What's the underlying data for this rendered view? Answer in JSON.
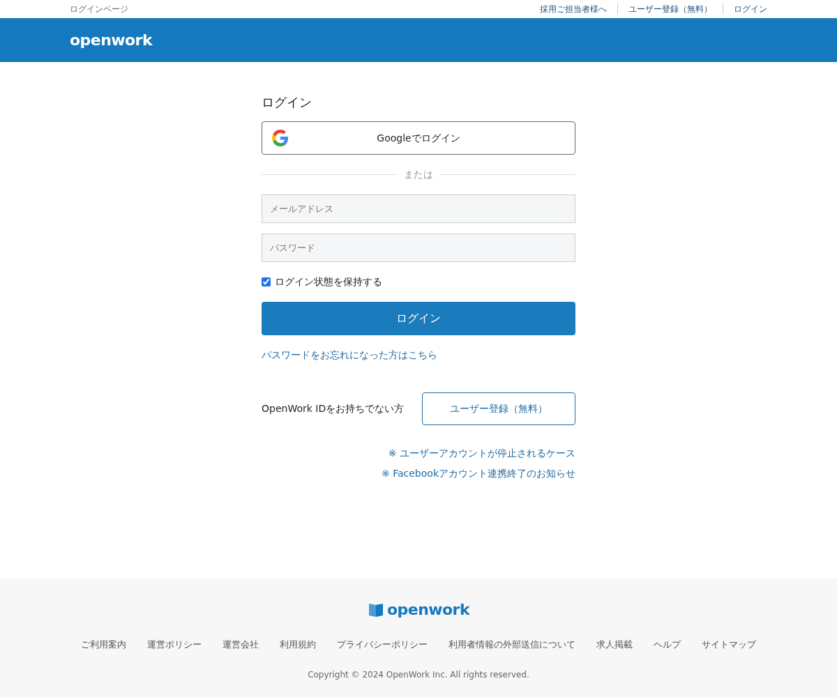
{
  "top_bar": {
    "page_label": "ログインページ",
    "links": [
      "採用ご担当者様へ",
      "ユーザー登録（無料）",
      "ログイン"
    ]
  },
  "header": {
    "logo": "openwork"
  },
  "login": {
    "title": "ログイン",
    "google_button": "Googleでログイン",
    "divider": "または",
    "email": {
      "placeholder": "メールアドレス"
    },
    "password": {
      "placeholder": "パスワード"
    },
    "remember": {
      "label": "ログイン状態を保持する",
      "checked": true
    },
    "submit": "ログイン",
    "forgot_link": "パスワードをお忘れになった方はこちら",
    "register_prompt": "OpenWork IDをお持ちでない方",
    "register_button": "ユーザー登録（無料）",
    "notices": [
      "※ ユーザーアカウントが停止されるケース",
      "※ Facebookアカウント連携終了のお知らせ"
    ]
  },
  "footer": {
    "logo": "openwork",
    "links": [
      "ご利用案内",
      "運営ポリシー",
      "運営会社",
      "利用規約",
      "プライバシーポリシー",
      "利用者情報の外部送信について",
      "求人掲載",
      "ヘルプ",
      "サイトマップ"
    ],
    "copyright": "Copyright © 2024 OpenWork Inc. All rights reserved."
  }
}
